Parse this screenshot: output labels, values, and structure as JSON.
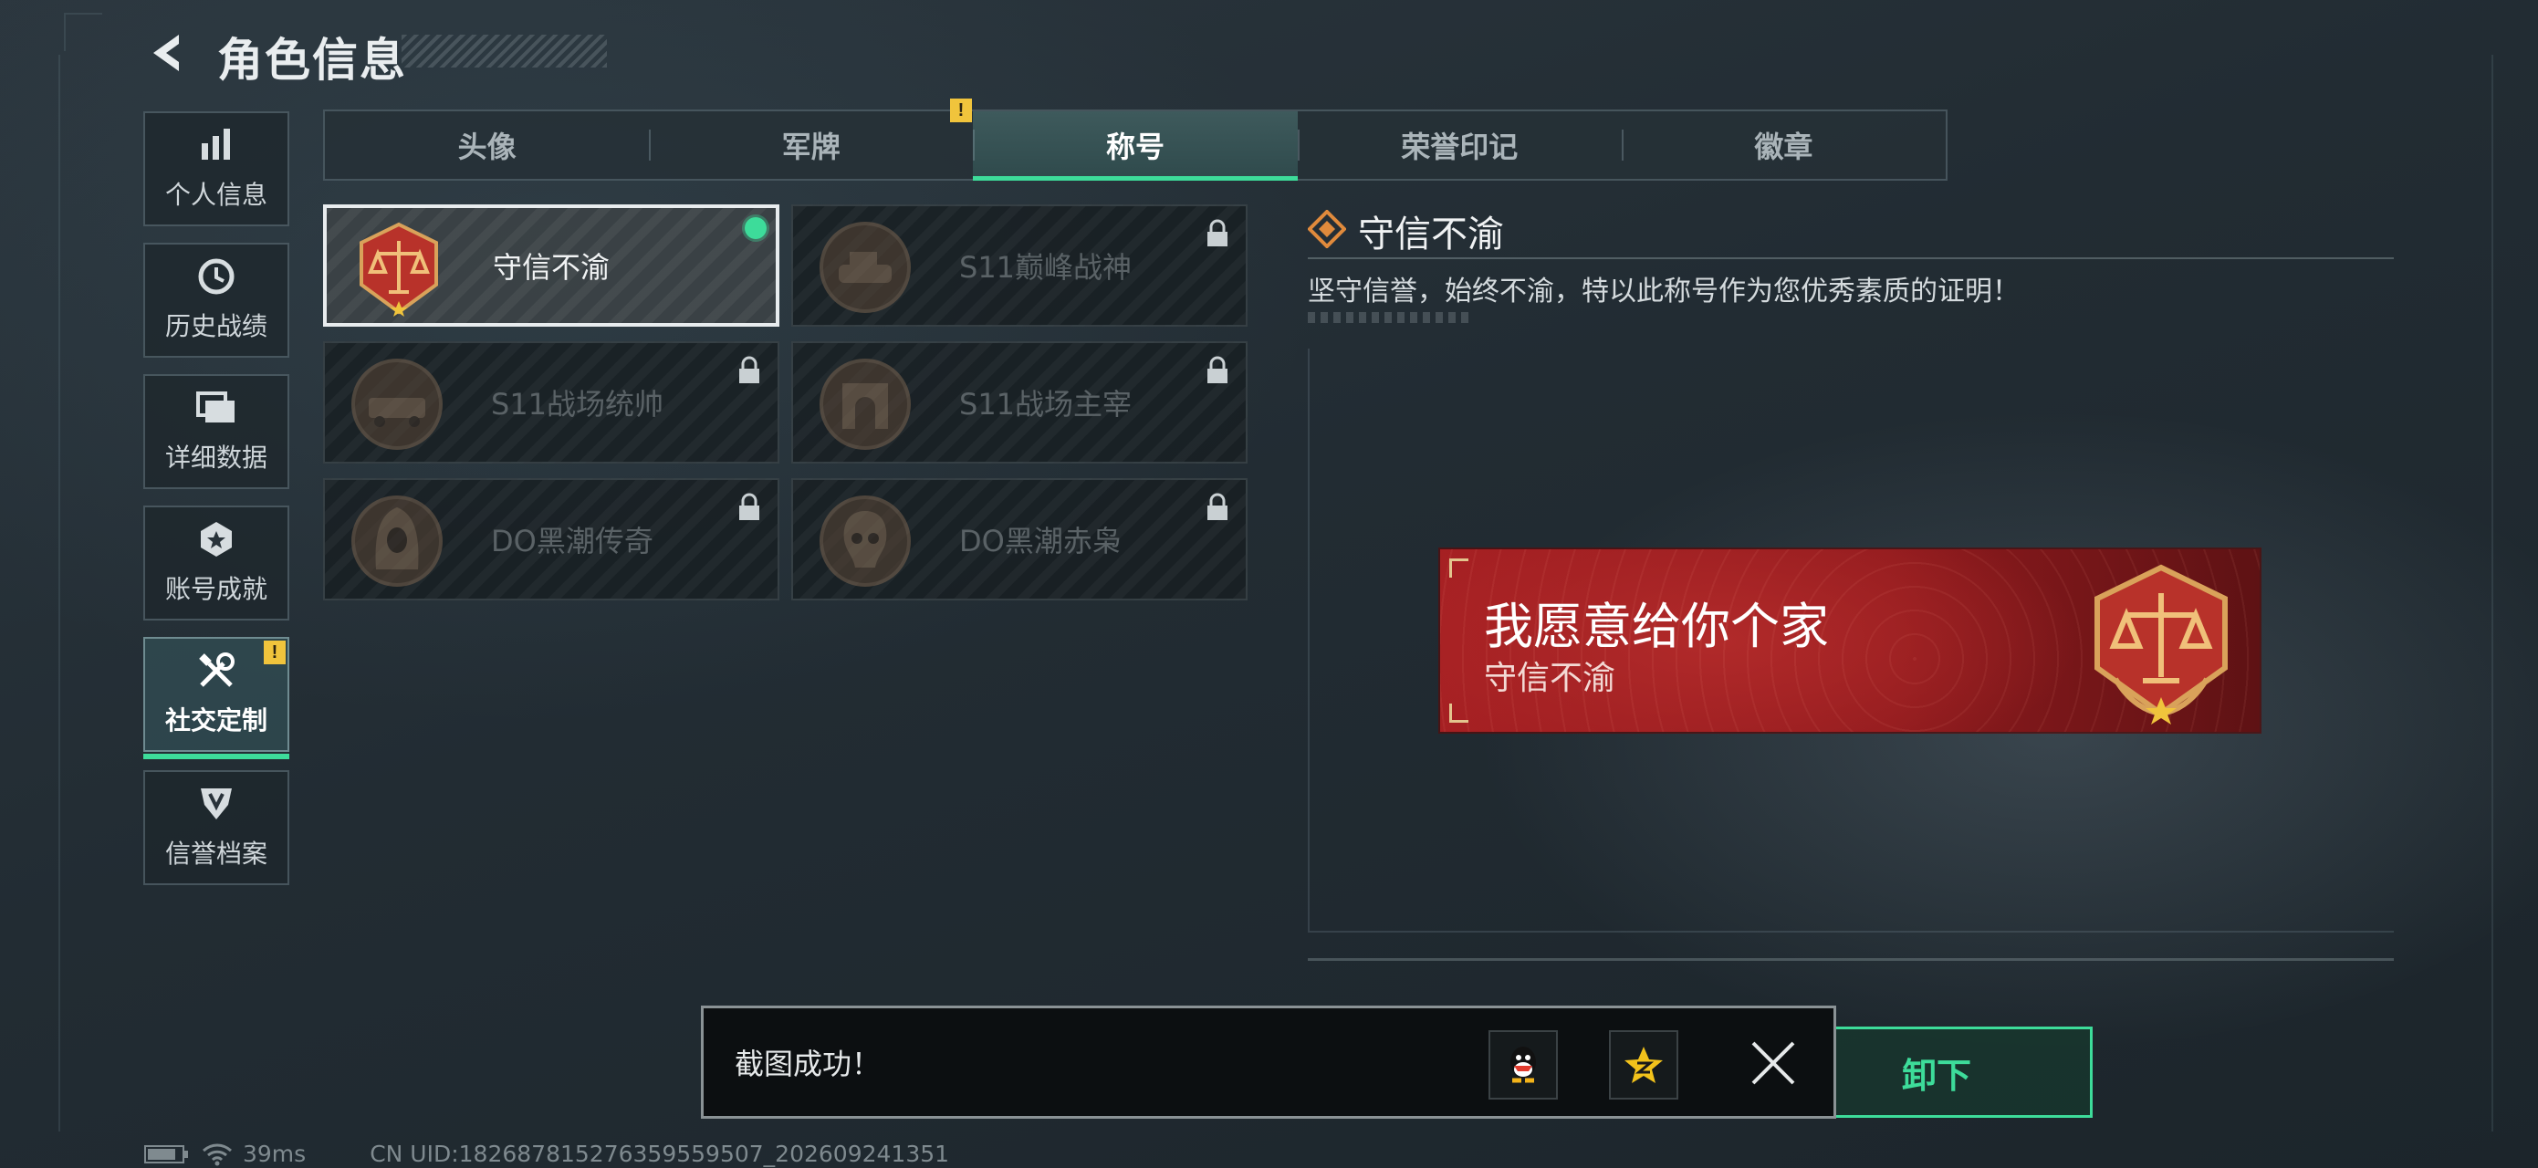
{
  "header": {
    "title": "角色信息"
  },
  "sidebar": {
    "items": [
      {
        "label": "个人信息",
        "icon": "bar-chart-icon"
      },
      {
        "label": "历史战绩",
        "icon": "clock-icon"
      },
      {
        "label": "详细数据",
        "icon": "folder-icon"
      },
      {
        "label": "账号成就",
        "icon": "medal-icon"
      },
      {
        "label": "社交定制",
        "icon": "tools-icon",
        "active": true,
        "badge": "!"
      },
      {
        "label": "信誉档案",
        "icon": "shield-icon"
      }
    ]
  },
  "tabs": [
    {
      "label": "头像"
    },
    {
      "label": "军牌",
      "badge": "!"
    },
    {
      "label": "称号",
      "active": true
    },
    {
      "label": "荣誉印记"
    },
    {
      "label": "徽章"
    }
  ],
  "titles": [
    {
      "name": "守信不渝",
      "selected": true,
      "equipped": true,
      "locked": false,
      "emblem": "scales-emblem"
    },
    {
      "name": "S11巅峰战神",
      "locked": true,
      "emblem": "tank-emblem"
    },
    {
      "name": "S11战场统帅",
      "locked": true,
      "emblem": "vehicle-emblem"
    },
    {
      "name": "S11战场主宰",
      "locked": true,
      "emblem": "arch-emblem"
    },
    {
      "name": "DO黑潮传奇",
      "locked": true,
      "emblem": "hooded-emblem"
    },
    {
      "name": "DO黑潮赤枭",
      "locked": true,
      "emblem": "skull-emblem"
    }
  ],
  "detail": {
    "title": "守信不渝",
    "description": "坚守信誉，始终不渝，特以此称号作为您优秀素质的证明！"
  },
  "nameplate": {
    "player_name": "我愿意给你个家",
    "title": "守信不渝"
  },
  "action": {
    "unequip_label": "卸下"
  },
  "toast": {
    "message": "截图成功！",
    "share_icons": [
      "qq-icon",
      "qzone-icon"
    ],
    "close_icon": "close-icon"
  },
  "footer": {
    "latency": "39ms",
    "uid": "CN UID:182687815276359559507_202609241351"
  },
  "colors": {
    "accent": "#3ddc9a",
    "nameplate": "#a51f22",
    "badge": "#f0c43c"
  }
}
